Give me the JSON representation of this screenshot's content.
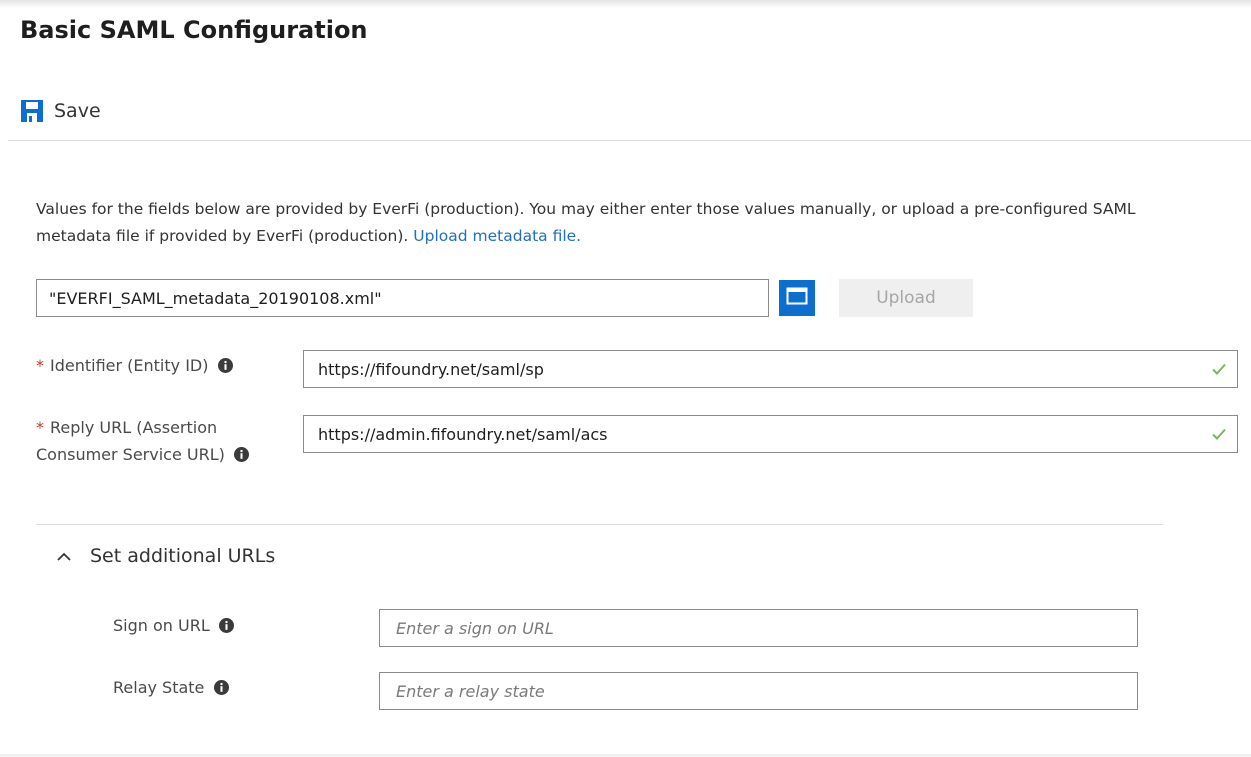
{
  "page": {
    "title": "Basic SAML Configuration"
  },
  "toolbar": {
    "save_label": "Save"
  },
  "description": {
    "text": "Values for the fields below are provided by EverFi (production). You may either enter those values manually, or upload a pre-configured SAML metadata file if provided by EverFi (production).",
    "link": "Upload metadata file."
  },
  "metadata_upload": {
    "file_value": "\"EVERFI_SAML_metadata_20190108.xml\"",
    "upload_label": "Upload"
  },
  "fields": {
    "identifier": {
      "required": "*",
      "label": "Identifier (Entity ID)",
      "value": "https://fifoundry.net/saml/sp"
    },
    "reply_url": {
      "required": "*",
      "label_line1": "Reply URL (Assertion",
      "label_line2": "Consumer Service URL)",
      "value": "https://admin.fifoundry.net/saml/acs"
    }
  },
  "additional": {
    "toggle_label": "Set additional URLs",
    "sign_on": {
      "label": "Sign on URL",
      "placeholder": "Enter a sign on URL"
    },
    "relay_state": {
      "label": "Relay State",
      "placeholder": "Enter a relay state"
    }
  },
  "colors": {
    "accent": "#0c6fcf",
    "link": "#1f6fbf",
    "required": "#c0392b",
    "valid_check": "#7bb662"
  },
  "icons": {
    "save": "save-icon",
    "browse": "folder-icon",
    "info": "info-icon",
    "valid": "checkmark-icon",
    "collapse": "chevron-up-icon"
  }
}
